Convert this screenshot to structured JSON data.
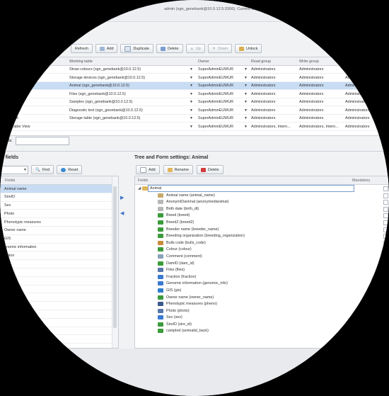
{
  "window": {
    "title": "admin (sgn_genebank@10.0.12.5:3306). Current user: ..."
  },
  "toolbar": {
    "refresh": "Refresh",
    "add": "Add",
    "duplicate": "Duplicate",
    "delete": "Delete",
    "up": "Up",
    "down": "Down",
    "unlock": "Unlock"
  },
  "grid": {
    "headers": {
      "working_table": "Working table",
      "owner": "Owner",
      "read_group": "Read group",
      "write_group": "Write group"
    },
    "rows": [
      {
        "name": "",
        "working": "Straw colours (sgn_genebank@10.0.12.5)",
        "owner": "SuperAdminEUWUR",
        "read": "Administrators",
        "write": "Administrators",
        "extra": "..."
      },
      {
        "name": "",
        "working": "Storage devices (sgn_genebank@10.0.12.5)",
        "owner": "SuperAdminEUWUR",
        "read": "Administrators",
        "write": "Administrators",
        "extra": "Adm..."
      },
      {
        "name": "",
        "working": "Animal (sgn_genebank@10.0.12.5)",
        "owner": "SuperAdminEUWUR",
        "read": "Administrators",
        "write": "Administrators",
        "extra": "Administ..."
      },
      {
        "name": "",
        "working": "Files (sgn_genebank@10.0.12.5)",
        "owner": "SuperAdminEUWUR",
        "read": "Administrators",
        "write": "Administrators",
        "extra": "Administr..."
      },
      {
        "name": "",
        "working": "Samples (sgn_genebank@10.0.12.5)",
        "owner": "SuperAdminEUWUR",
        "read": "Administrators",
        "write": "Administrators",
        "extra": "Administrat..."
      },
      {
        "name": "nostic tests",
        "working": "Diagnostic test (sgn_genebank@10.0.12.5)",
        "owner": "SuperAdminEUWUR",
        "read": "Administrators",
        "write": "Administrators",
        "extra": "Administrators"
      },
      {
        "name": "rage table",
        "working": "Storage table (sgn_genebank@10.0.12.5)",
        "owner": "SuperAdminEUWUR",
        "read": "Administrators",
        "write": "Administrators",
        "extra": "Administrators"
      },
      {
        "name": "efault Table View",
        "working": "",
        "owner": "SuperAdminEUWUR",
        "read": "Administrators, Intern...",
        "write": "Administrators, Intern...",
        "extra": "Administrators"
      }
    ]
  },
  "records_label": "ecords:",
  "left": {
    "title": "le fields",
    "find": "Find",
    "reset": "Reset",
    "header": "Fields",
    "items": [
      "Animal name",
      "SireID",
      "Sex",
      "Photo",
      "Phenotypic measures",
      "Owner name",
      "GIS",
      "enomic information",
      "action",
      "",
      "",
      "D",
      "ent",
      "",
      "",
      "",
      "anization",
      "",
      "",
      ""
    ]
  },
  "right": {
    "title": "Tree and Form settings: Animal",
    "add": "Add",
    "rename": "Rename",
    "delete": "Delete",
    "col_fields": "Fields",
    "col_mandatory": "Mandatory",
    "root": "Animal",
    "items": [
      {
        "label": "Animal name (animal_name)",
        "icon": "#c8a86a"
      },
      {
        "label": "AnonymIDanimal (anonymeidanimal)",
        "icon": "#b7b7b7"
      },
      {
        "label": "Birth date (birth_dt)",
        "icon": "#b7b7b7"
      },
      {
        "label": "Breed (breed)",
        "icon": "#3b9b3b"
      },
      {
        "label": "Breed2 (breed2)",
        "icon": "#3b9b3b"
      },
      {
        "label": "Breeder name (breeder_name)",
        "icon": "#3b9b3b"
      },
      {
        "label": "Breeding organization (breeding_organization)",
        "icon": "#3b9b3b"
      },
      {
        "label": "Bulls code (bulls_code)",
        "icon": "#c98a3a"
      },
      {
        "label": "Colour (colour)",
        "icon": "#3b9b3b"
      },
      {
        "label": "Comment (comment)",
        "icon": "#8aa1b9"
      },
      {
        "label": "DamID (dam_id)",
        "icon": "#3b9b3b"
      },
      {
        "label": "Files (files)",
        "icon": "#5577aa"
      },
      {
        "label": "Fraction (fraction)",
        "icon": "#3a7ad0"
      },
      {
        "label": "Genomic information (genomic_info)",
        "icon": "#3a7ad0"
      },
      {
        "label": "GIS (gis)",
        "icon": "#2f7dcc"
      },
      {
        "label": "Owner name (owner_name)",
        "icon": "#3b9b3b"
      },
      {
        "label": "Phenotypic measures (pheno)",
        "icon": "#3b5a8a"
      },
      {
        "label": "Photo (photo)",
        "icon": "#5577aa"
      },
      {
        "label": "Sex (sex)",
        "icon": "#3a7ad0"
      },
      {
        "label": "SireID (sire_id)",
        "icon": "#3b9b3b"
      },
      {
        "label": "campled (animalid_back)",
        "icon": "#3b9b3b"
      }
    ]
  }
}
